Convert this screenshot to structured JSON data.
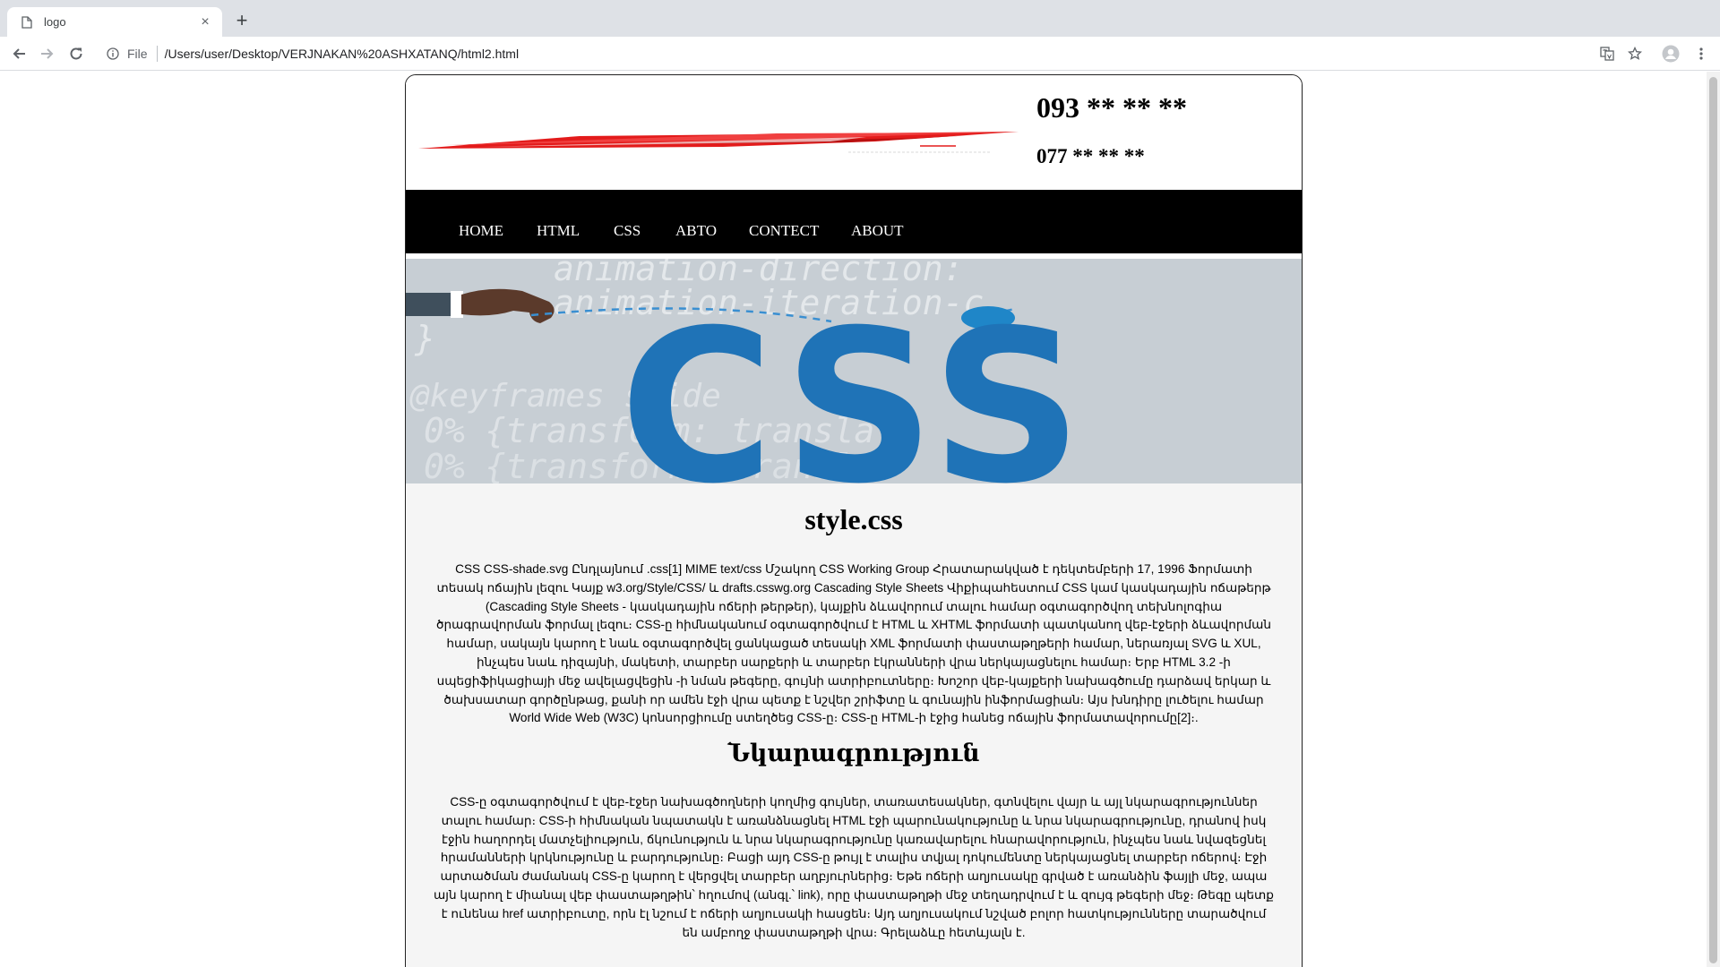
{
  "browser": {
    "tab_title": "logo",
    "tab_close": "×",
    "new_tab": "+",
    "scheme_label": "File",
    "url": "/Users/user/Desktop/VERJNAKAN%20ASHXATANQ/html2.html"
  },
  "header": {
    "phone_primary": "093 ** ** **",
    "phone_secondary": "077 ** ** **"
  },
  "nav": {
    "items": [
      {
        "label": "HOME"
      },
      {
        "label": "HTML"
      },
      {
        "label": "CSS"
      },
      {
        "label": "ABTO"
      },
      {
        "label": "CONTECT"
      },
      {
        "label": "ABOUT"
      }
    ]
  },
  "hero": {
    "code_line_1": "animation-direction:",
    "code_line_2": "animation-iteration-c",
    "code_line_3": "@keyframes slide",
    "code_line_4": "0% {transform: transla",
    "code_line_5": "0% {transform: transl",
    "code_brace": "}",
    "logo_text": "CSS"
  },
  "article": {
    "title": "style.css",
    "intro": "CSS CSS-shade.svg Ընդլայնում .css[1] MIME text/css Մշակող CSS Working Group Հրատարակված է դեկտեմբերի 17, 1996 Ֆորմատի տեսակ ոճային լեզու Կայք w3.org/Style/CSS/ և drafts.csswg.org Cascading Style Sheets Վիքիպահեստում CSS կամ կասկադային ոճաթերթ (Cascading Style Sheets - կասկադային ոճերի թերթեր), կայքին ձևավորում տալու համար օգտագործվող տեխնոլոգիա ծրագրավորման ֆորմալ լեզու։ CSS-ը հիմնականում օգտագործվում է HTML և XHTML ֆորմատի պատկանող վեբ-էջերի ձևավորման համար, սակայն կարող է նաև օգտագործվել ցանկացած տեսակի XML ֆորմատի փաստաթղթերի համար, ներառյալ SVG և XUL, ինչպես նաև դիզայնի, մակետի, տարբեր սարքերի և տարբեր էկրանների վրա ներկայացնելու համար։ Երբ HTML 3.2 -ի սպեցիֆիկացիայի մեջ ավելացվեցին -ի նման թեգերը, գույնի ատրիբուտները։ Խոշոր վեբ-կայքերի նախագծումը դարձավ երկար և ծախսատար գործընթաց, քանի որ ամեն էջի վրա պետք է նշվեր շրիֆտը և գունային ինֆորմացիան։ Այս խնդիրը լուծելու համար World Wide Web (W3C) կոնսորցիումը ստեղծեց CSS-ը։ CSS-ը HTML-ի էջից հանեց ոճային ֆորմատավորումը[2]։.",
    "section_title": "Նկարագրություն",
    "description": "CSS-ը օգտագործվում է վեբ-էջեր նախագծողների կողմից գույներ, տառատեսակներ, գտնվելու վայր և այլ նկարագրություններ տալու համար։ CSS-ի հիմնական նպատակն է առանձնացնել HTML էջի պարունակությունը և նրա նկարագրությունը, դրանով իսկ էջին հաղորդել մատչելիություն, ճկունություն և նրա նկարագրությունը կառավարելու հնարավորություն, ինչպես նաև նվազեցնել հրամանների կրկնությունը և բարդությունը։ Բացի այդ CSS-ը թույլ է տալիս տվյալ դոկումենտը ներկայացնել տարբեր ոճերով։ Էջի արտածման ժամանակ CSS-ը կարող է վերցվել տարբեր աղբյուրներից։ Եթե ոճերի աղյուսակը գրված է առանձին ֆայլի մեջ, ապա այն կարող է միանալ վեբ փաստաթղթին՝ հղումով (անգլ.՝ link), որը փաստաթղթի մեջ տեղադրվում է և զույգ թեգերի մեջ։ Թեգը պետք է ունենա href ատրիբուտը, որն էլ նշում է ոճերի աղյուսակի հասցեն։ Այդ աղյուսակում նշված բոլոր հատկությունները տարածվում են ամբողջ փաստաթղթի վրա։ Գրելաձևը հետևյալն է."
  },
  "icons": {
    "page": "document-icon",
    "back": "arrow-left-icon",
    "forward": "arrow-right-icon",
    "reload": "reload-icon",
    "info": "info-icon",
    "translate": "translate-icon",
    "bookmark": "star-icon",
    "profile": "account-icon",
    "menu": "kebab-menu-icon"
  },
  "colors": {
    "logo_red": "#e31b1b",
    "nav_background": "#000000",
    "css_blue": "#1f73b7",
    "hero_background": "#c7ced4",
    "content_background": "#f5f5f5"
  }
}
